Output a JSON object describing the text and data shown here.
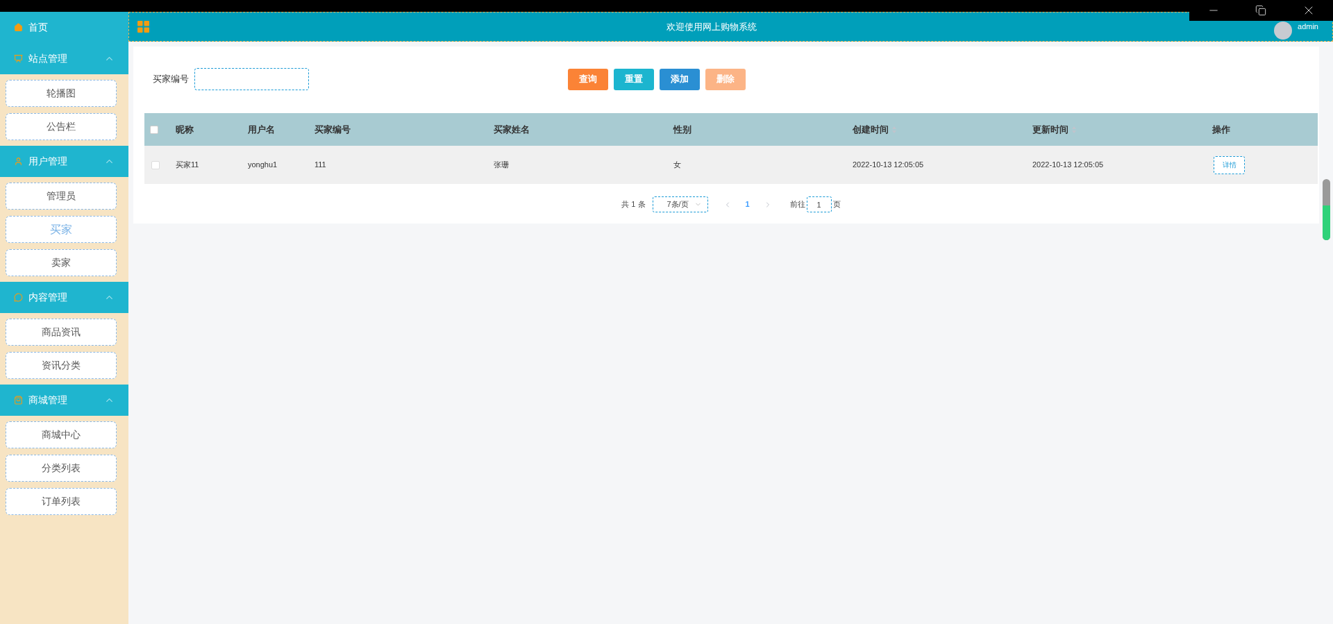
{
  "header": {
    "title": "欢迎使用网上购物系统",
    "user": "admin"
  },
  "sidebar": {
    "home": "首页",
    "groups": [
      {
        "title": "站点管理",
        "expanded": true,
        "items": [
          {
            "label": "轮播图",
            "selected": false
          },
          {
            "label": "公告栏",
            "selected": false
          }
        ]
      },
      {
        "title": "用户管理",
        "expanded": true,
        "items": [
          {
            "label": "管理员",
            "selected": false
          },
          {
            "label": "买家",
            "selected": true
          },
          {
            "label": "卖家",
            "selected": false
          }
        ]
      },
      {
        "title": "内容管理",
        "expanded": true,
        "items": [
          {
            "label": "商品资讯",
            "selected": false
          },
          {
            "label": "资讯分类",
            "selected": false
          }
        ]
      },
      {
        "title": "商城管理",
        "expanded": true,
        "items": [
          {
            "label": "商城中心",
            "selected": false
          },
          {
            "label": "分类列表",
            "selected": false
          },
          {
            "label": "订单列表",
            "selected": false
          }
        ]
      }
    ]
  },
  "search": {
    "label": "买家编号"
  },
  "buttons": [
    {
      "label": "查询",
      "kind": "query",
      "disabled": false
    },
    {
      "label": "重置",
      "kind": "reset",
      "disabled": false
    },
    {
      "label": "添加",
      "kind": "add",
      "disabled": false
    },
    {
      "label": "删除",
      "kind": "delete",
      "disabled": true
    }
  ],
  "table": {
    "columns": [
      {
        "label": "昵称",
        "sortable": false
      },
      {
        "label": "用户名",
        "sortable": false
      },
      {
        "label": "买家编号",
        "sortable": false
      },
      {
        "label": "买家姓名",
        "sortable": false
      },
      {
        "label": "性别",
        "sortable": false
      },
      {
        "label": "创建时间",
        "sortable": true
      },
      {
        "label": "更新时间",
        "sortable": true
      },
      {
        "label": "操作",
        "sortable": false
      }
    ],
    "all_checked": false,
    "rows": [
      {
        "checked": false,
        "cells": [
          "买家11",
          "yonghu1",
          "111",
          "张珊",
          "女",
          "2022-10-13 12:05:05",
          "2022-10-13 12:05:05"
        ],
        "action": "详情"
      }
    ]
  },
  "pagination": {
    "total": "共 1 条",
    "page_size": "7条/页",
    "pages": [
      {
        "label": "1",
        "selected": true
      }
    ],
    "goto_label": "前往",
    "goto_value": "1",
    "goto_suffix": "页"
  }
}
